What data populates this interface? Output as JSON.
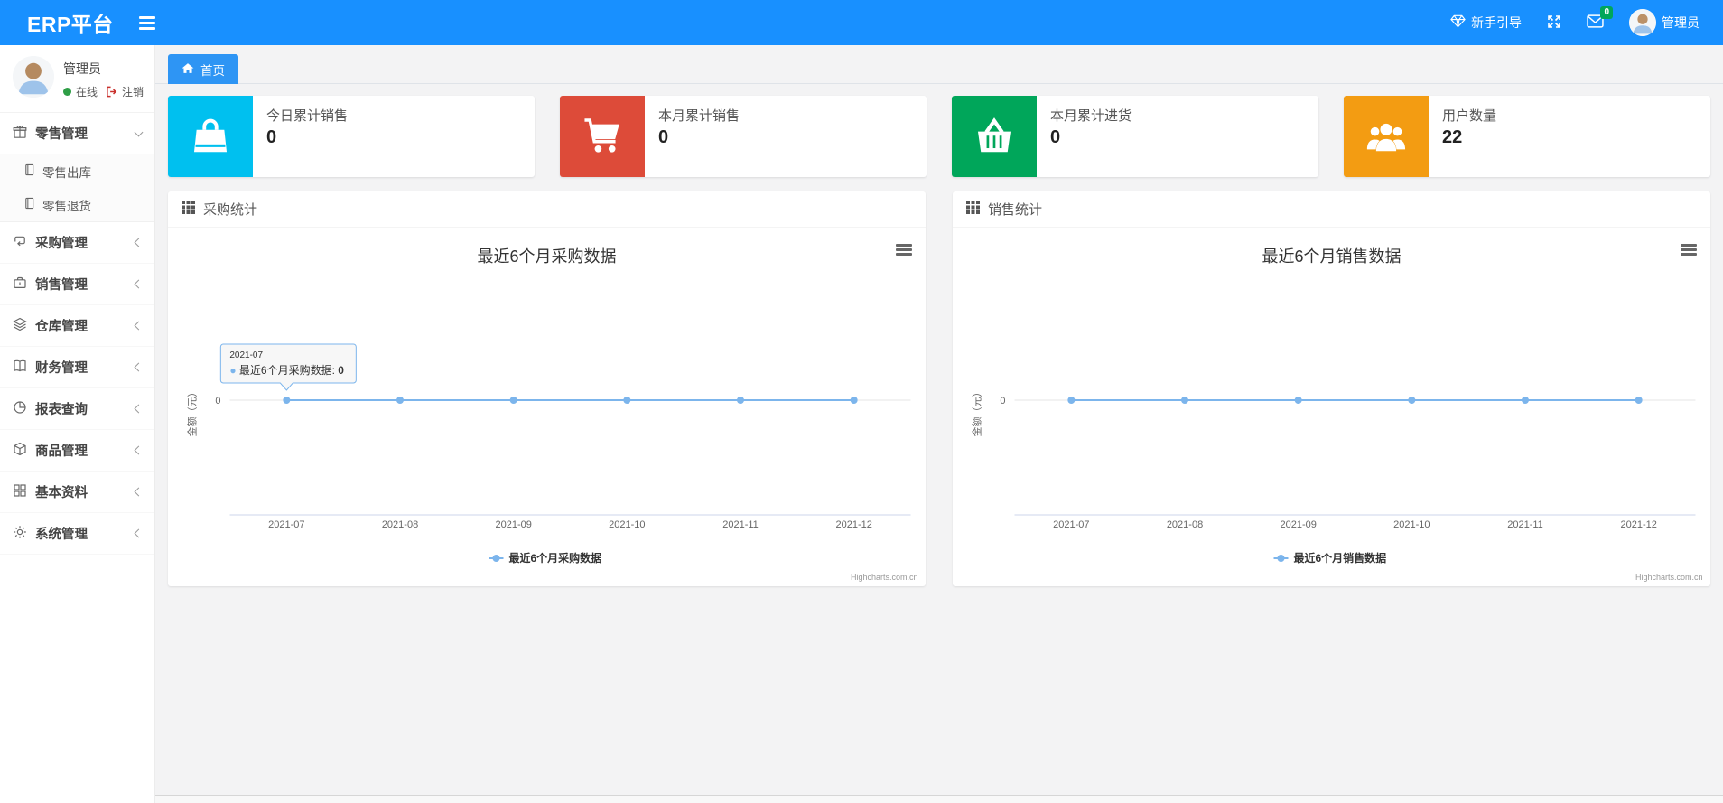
{
  "header": {
    "brand": "ERP平台",
    "guide_label": "新手引导",
    "mail_badge": "0",
    "username": "管理员"
  },
  "sidebar": {
    "profile": {
      "name": "管理员",
      "status": "在线",
      "logout": "注销"
    },
    "menu": [
      {
        "label": "零售管理",
        "icon": "gift-icon",
        "state": "expanded",
        "children": [
          {
            "label": "零售出库",
            "icon": "document-icon"
          },
          {
            "label": "零售退货",
            "icon": "document-icon"
          }
        ]
      },
      {
        "label": "采购管理",
        "icon": "repeat-icon",
        "state": "collapsed"
      },
      {
        "label": "销售管理",
        "icon": "briefcase-icon",
        "state": "collapsed"
      },
      {
        "label": "仓库管理",
        "icon": "layers-icon",
        "state": "collapsed"
      },
      {
        "label": "财务管理",
        "icon": "open-book-icon",
        "state": "collapsed"
      },
      {
        "label": "报表查询",
        "icon": "pie-chart-icon",
        "state": "collapsed"
      },
      {
        "label": "商品管理",
        "icon": "cube-icon",
        "state": "collapsed"
      },
      {
        "label": "基本资料",
        "icon": "grid-icon",
        "state": "collapsed"
      },
      {
        "label": "系统管理",
        "icon": "gear-icon",
        "state": "collapsed"
      }
    ]
  },
  "tabs": {
    "home": "首页"
  },
  "stat_cards": [
    {
      "label": "今日累计销售",
      "value": "0",
      "color": "#00c0ef",
      "icon": "shopping-bag-icon"
    },
    {
      "label": "本月累计销售",
      "value": "0",
      "color": "#dd4b39",
      "icon": "shopping-cart-icon"
    },
    {
      "label": "本月累计进货",
      "value": "0",
      "color": "#00a65a",
      "icon": "shopping-basket-icon"
    },
    {
      "label": "用户数量",
      "value": "22",
      "color": "#f39c12",
      "icon": "users-icon"
    }
  ],
  "panels": [
    {
      "title": "采购统计"
    },
    {
      "title": "销售统计"
    }
  ],
  "chart_data": [
    {
      "type": "line",
      "title": "最近6个月采购数据",
      "categories": [
        "2021-07",
        "2021-08",
        "2021-09",
        "2021-10",
        "2021-11",
        "2021-12"
      ],
      "series": [
        {
          "name": "最近6个月采购数据",
          "values": [
            0,
            0,
            0,
            0,
            0,
            0
          ]
        }
      ],
      "xlabel": "",
      "ylabel": "金额（元）",
      "y_tick_labels": [
        "0"
      ],
      "ylim": [
        0,
        1
      ],
      "grid": true,
      "legend_position": "bottom",
      "line_color": "#7cb5ec",
      "credit": "Highcharts.com.cn",
      "tooltip": {
        "header": "2021-07",
        "series": "最近6个月采购数据",
        "value": "0",
        "point_index": 0
      }
    },
    {
      "type": "line",
      "title": "最近6个月销售数据",
      "categories": [
        "2021-07",
        "2021-08",
        "2021-09",
        "2021-10",
        "2021-11",
        "2021-12"
      ],
      "series": [
        {
          "name": "最近6个月销售数据",
          "values": [
            0,
            0,
            0,
            0,
            0,
            0
          ]
        }
      ],
      "xlabel": "",
      "ylabel": "金额（元）",
      "y_tick_labels": [
        "0"
      ],
      "ylim": [
        0,
        1
      ],
      "grid": true,
      "legend_position": "bottom",
      "line_color": "#7cb5ec",
      "credit": "Highcharts.com.cn"
    }
  ]
}
